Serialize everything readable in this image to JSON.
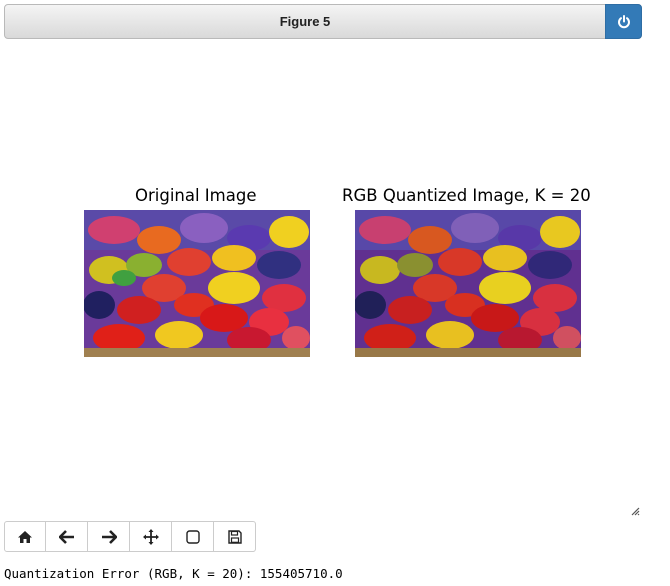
{
  "figure": {
    "title": "Figure 5",
    "close_icon": "power-icon",
    "accent_color": "#337ab7"
  },
  "subplots": [
    {
      "title": "Original Image"
    },
    {
      "title": "RGB Quantized Image, K = 20"
    }
  ],
  "toolbar": {
    "buttons": [
      {
        "name": "home",
        "icon": "home-icon"
      },
      {
        "name": "back",
        "icon": "arrow-left-icon"
      },
      {
        "name": "forward",
        "icon": "arrow-right-icon"
      },
      {
        "name": "pan",
        "icon": "move-icon"
      },
      {
        "name": "zoom",
        "icon": "square-icon"
      },
      {
        "name": "save",
        "icon": "floppy-disk-icon"
      }
    ]
  },
  "output": {
    "text": "Quantization Error (RGB, K = 20): 155405710.0"
  }
}
